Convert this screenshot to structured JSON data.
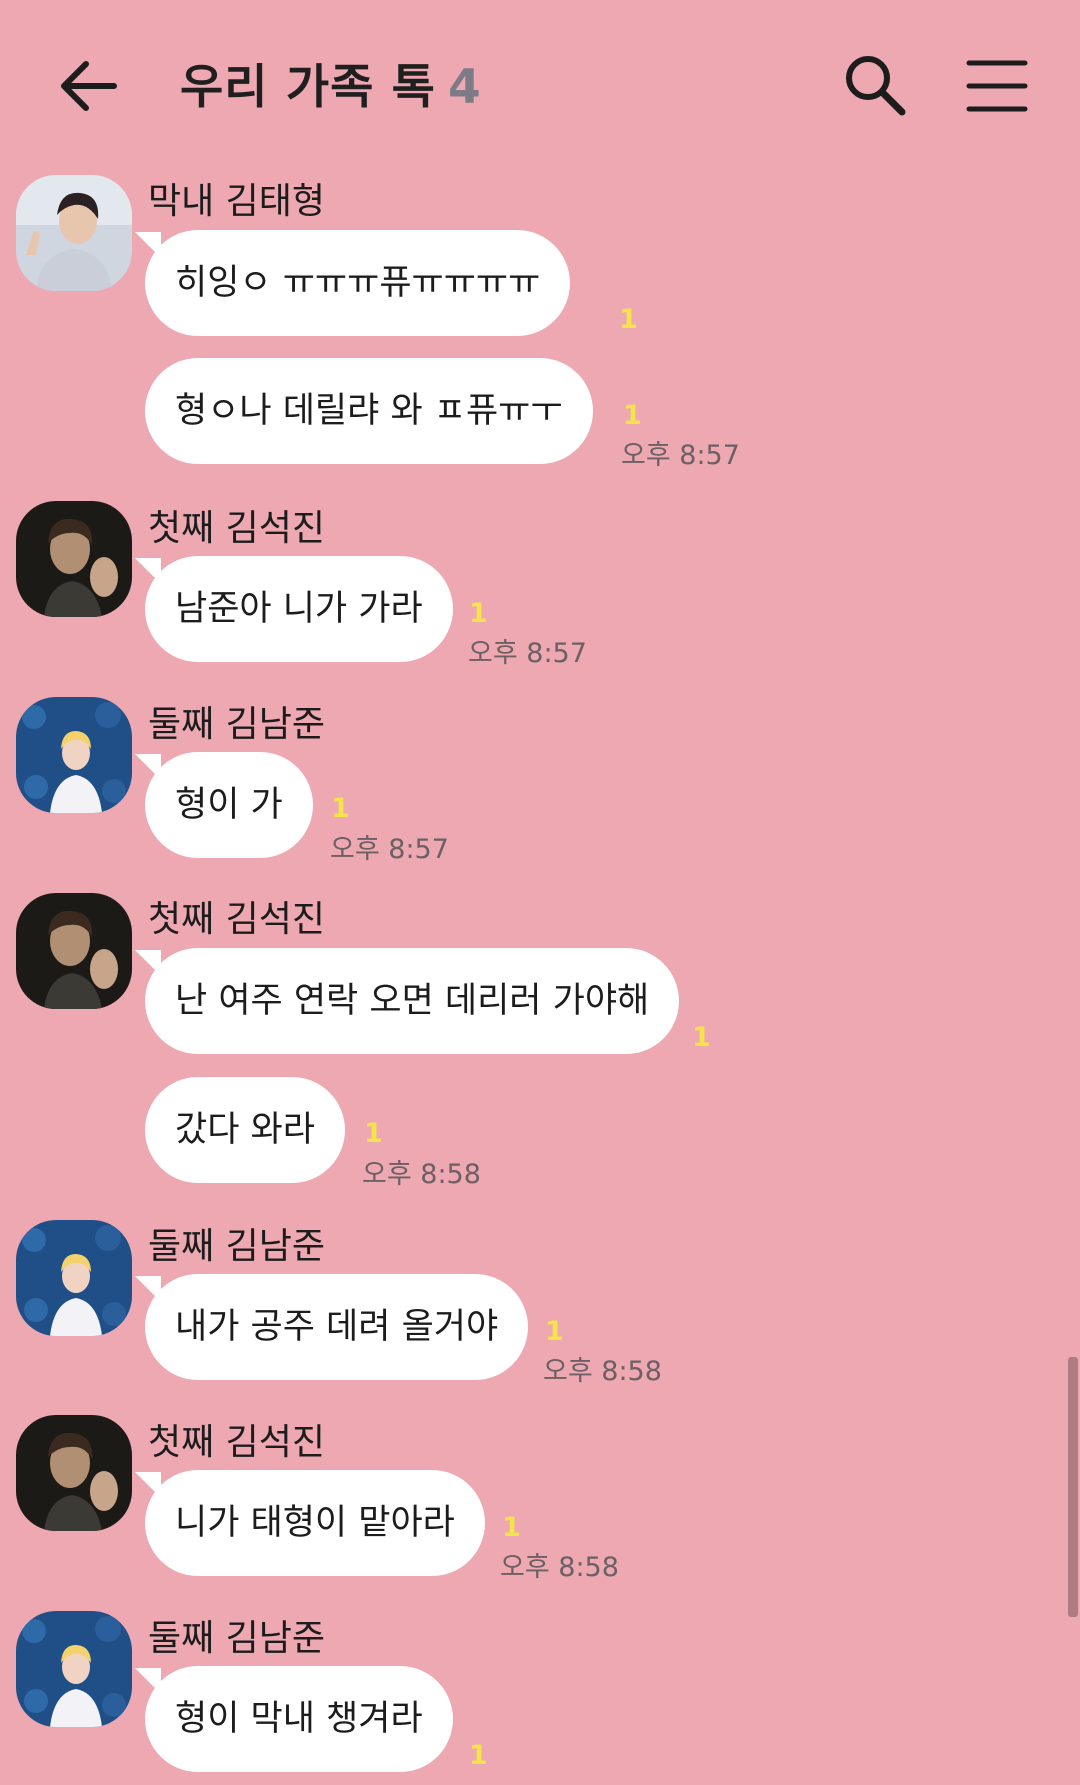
{
  "header": {
    "back_icon": "arrow-left-icon",
    "title": "우리 가족 톡",
    "member_count": "4",
    "search_icon": "search-icon",
    "menu_icon": "hamburger-menu-icon"
  },
  "colors": {
    "background": "#eda8b2",
    "bubble": "#ffffff",
    "unread": "#f4e44b",
    "time": "#6c6064",
    "member_count": "#7d7c86"
  },
  "messages": [
    {
      "sender": "막내 김태형",
      "bubbles": [
        {
          "text": "히잉ㅇ ㅠㅠㅠ퓨ㅠㅠㅠㅠ",
          "unread": "1",
          "time": ""
        },
        {
          "text": "형ㅇ나 데릴랴 와 ㅍ퓨ㅠㅜ",
          "unread": "1",
          "time": "오후 8:57"
        }
      ]
    },
    {
      "sender": "첫째 김석진",
      "bubbles": [
        {
          "text": "남준아 니가 가라",
          "unread": "1",
          "time": "오후 8:57"
        }
      ]
    },
    {
      "sender": "둘째 김남준",
      "bubbles": [
        {
          "text": "형이 가",
          "unread": "1",
          "time": "오후 8:57"
        }
      ]
    },
    {
      "sender": "첫째 김석진",
      "bubbles": [
        {
          "text": "난 여주 연락 오면 데리러 가야해",
          "unread": "1",
          "time": ""
        },
        {
          "text": "갔다 와라",
          "unread": "1",
          "time": "오후 8:58"
        }
      ]
    },
    {
      "sender": "둘째 김남준",
      "bubbles": [
        {
          "text": "내가 공주 데려 올거야",
          "unread": "1",
          "time": "오후 8:58"
        }
      ]
    },
    {
      "sender": "첫째 김석진",
      "bubbles": [
        {
          "text": "니가 태형이 맡아라",
          "unread": "1",
          "time": "오후 8:58"
        }
      ]
    },
    {
      "sender": "둘째 김남준",
      "bubbles": [
        {
          "text": "형이 막내 챙겨라",
          "unread": "1",
          "time": ""
        }
      ]
    }
  ]
}
